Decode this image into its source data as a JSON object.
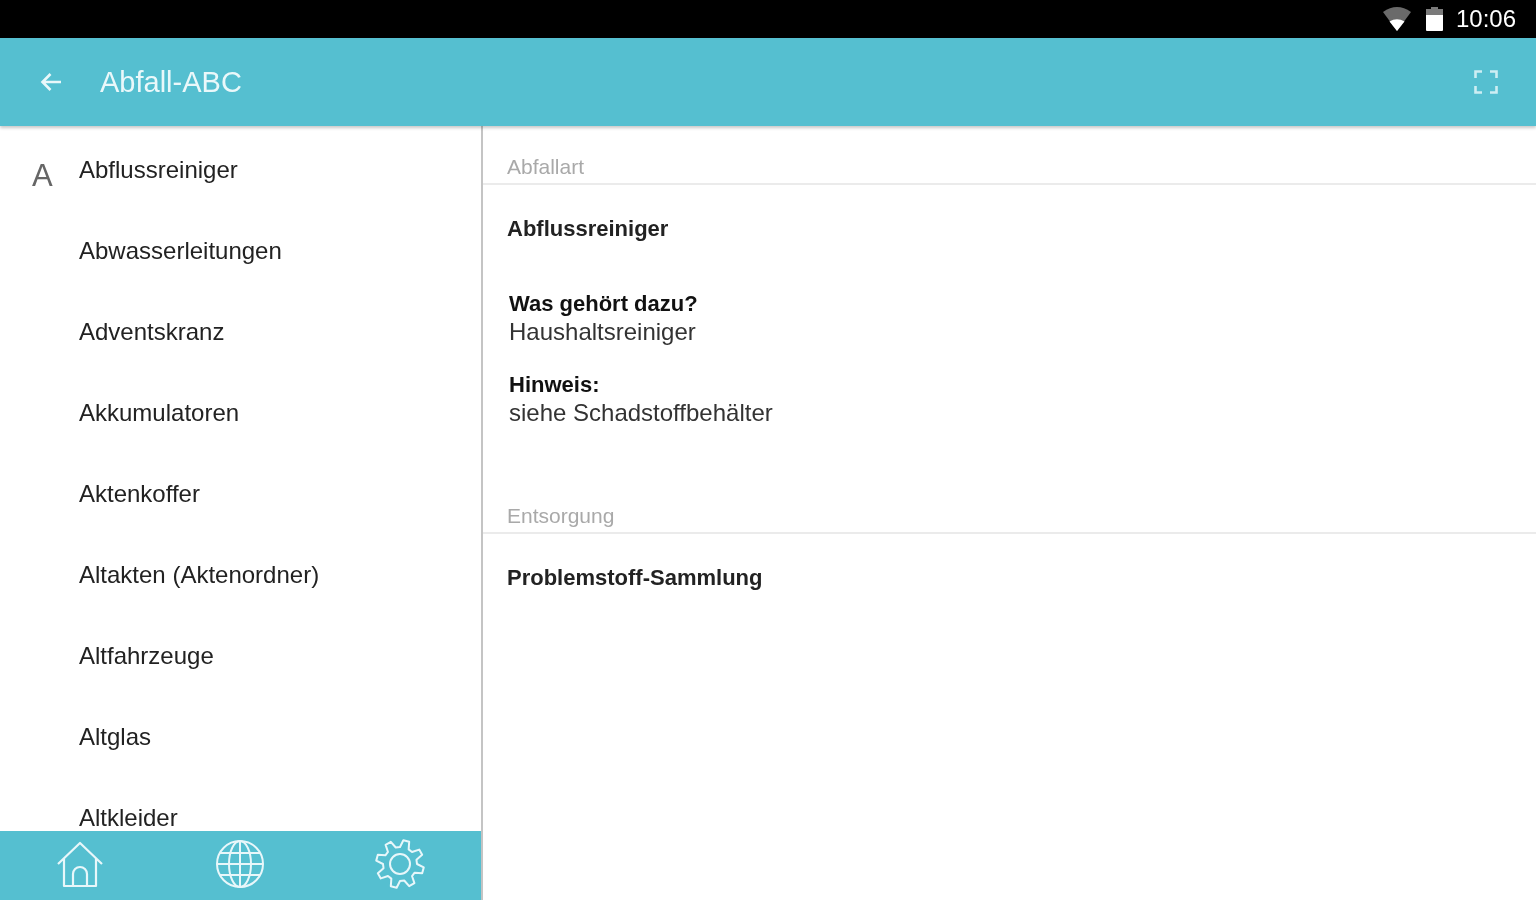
{
  "status_bar": {
    "time": "10:06"
  },
  "toolbar": {
    "title": "Abfall-ABC"
  },
  "index": {
    "sections": [
      {
        "letter": "A",
        "items": [
          "Abflussreiniger",
          "Abwasserleitungen",
          "Adventskranz",
          "Akkumulatoren",
          "Aktenkoffer",
          "Altakten (Aktenordner)",
          "Altfahrzeuge",
          "Altglas",
          "Altkleider"
        ]
      }
    ]
  },
  "detail": {
    "sections": [
      {
        "heading": "Abfallart",
        "blocks": [
          {
            "kind": "title",
            "text": "Abflussreiniger"
          },
          {
            "kind": "field",
            "label": "Was gehört dazu?",
            "value": "Haushaltsreiniger"
          },
          {
            "kind": "field",
            "label": "Hinweis:",
            "value": "siehe Schadstoffbehälter"
          }
        ]
      },
      {
        "heading": "Entsorgung",
        "blocks": [
          {
            "kind": "title",
            "text": "Problemstoff-Sammlung"
          }
        ]
      }
    ]
  }
}
